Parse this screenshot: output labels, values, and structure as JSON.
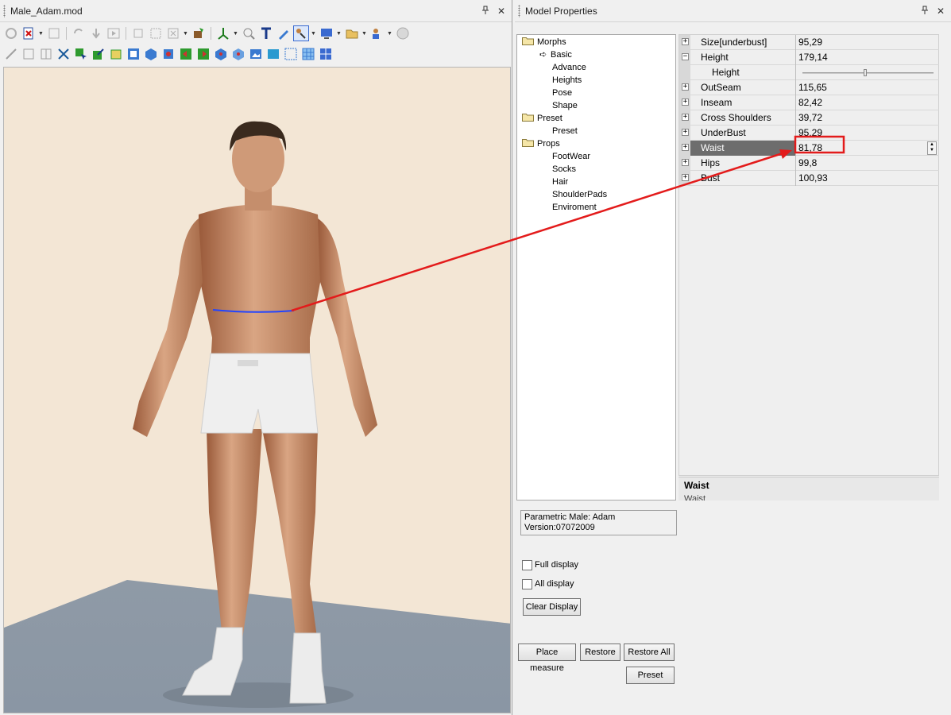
{
  "left_window": {
    "title": "Male_Adam.mod",
    "pin_icon": "pin-icon",
    "close_icon": "close-icon"
  },
  "right_window": {
    "title": "Model Properties"
  },
  "tree": {
    "groups": [
      {
        "label": "Morphs",
        "children": [
          "Basic",
          "Advance",
          "Heights",
          "Pose",
          "Shape"
        ]
      },
      {
        "label": "Preset",
        "children": [
          "Preset"
        ]
      },
      {
        "label": "Props",
        "children": [
          "FootWear",
          "Socks",
          "Hair",
          "ShoulderPads",
          "Enviroment"
        ]
      }
    ],
    "selected_marker": "Basic"
  },
  "properties": [
    {
      "expander": "+",
      "name": "Size[underbust]",
      "value": "95,29"
    },
    {
      "expander": "−",
      "name": "Height",
      "value": "179,14"
    },
    {
      "expander": "",
      "name": "Height",
      "value": "",
      "slider": 0.48
    },
    {
      "expander": "+",
      "name": "OutSeam",
      "value": "115,65"
    },
    {
      "expander": "+",
      "name": "Inseam",
      "value": "82,42"
    },
    {
      "expander": "+",
      "name": "Cross Shoulders",
      "value": "39,72"
    },
    {
      "expander": "+",
      "name": "UnderBust",
      "value": "95,29"
    },
    {
      "expander": "+",
      "name": "Waist",
      "value": "81,78",
      "selected": true
    },
    {
      "expander": "+",
      "name": "Hips",
      "value": "99,8"
    },
    {
      "expander": "+",
      "name": "Bust",
      "value": "100,93"
    }
  ],
  "description": {
    "title": "Waist",
    "text": "Waist"
  },
  "model_info": {
    "line1": "Parametric Male: Adam",
    "line2": "Version:07072009"
  },
  "options": {
    "full_display": "Full display",
    "all_display": "All display",
    "clear_display": "Clear Display"
  },
  "buttons": {
    "place_measure": "Place measure",
    "restore": "Restore",
    "restore_all": "Restore All",
    "preset": "Preset"
  },
  "colors": {
    "annotation": "#e31b1b",
    "measure_line": "#2244ff",
    "selected_row": "#6d6d6d"
  }
}
